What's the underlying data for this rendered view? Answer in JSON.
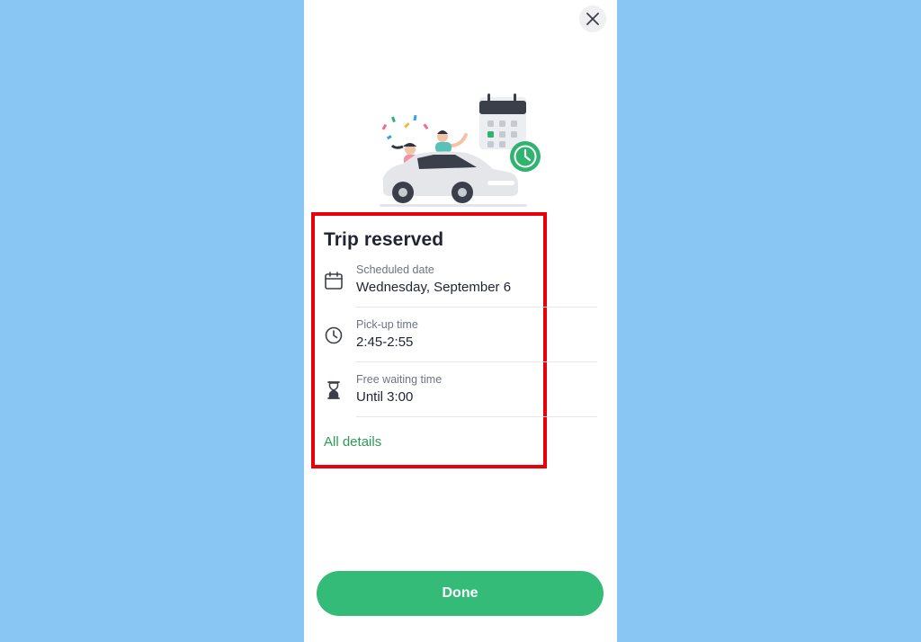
{
  "app": {
    "close_icon": "close-icon"
  },
  "illustration": {
    "name": "car-trip-reserved-illustration"
  },
  "card": {
    "title": "Trip reserved",
    "rows": [
      {
        "icon": "calendar-icon",
        "label": "Scheduled date",
        "value": "Wednesday, September 6"
      },
      {
        "icon": "clock-icon",
        "label": "Pick-up time",
        "value": "2:45-2:55"
      },
      {
        "icon": "hourglass-icon",
        "label": "Free waiting time",
        "value": "Until 3:00"
      }
    ],
    "details_link": "All details"
  },
  "footer": {
    "done_label": "Done"
  },
  "colors": {
    "accent": "#34bb78",
    "link": "#2a9d55",
    "highlight": "#e8000b",
    "background": "#8ac6f4"
  }
}
